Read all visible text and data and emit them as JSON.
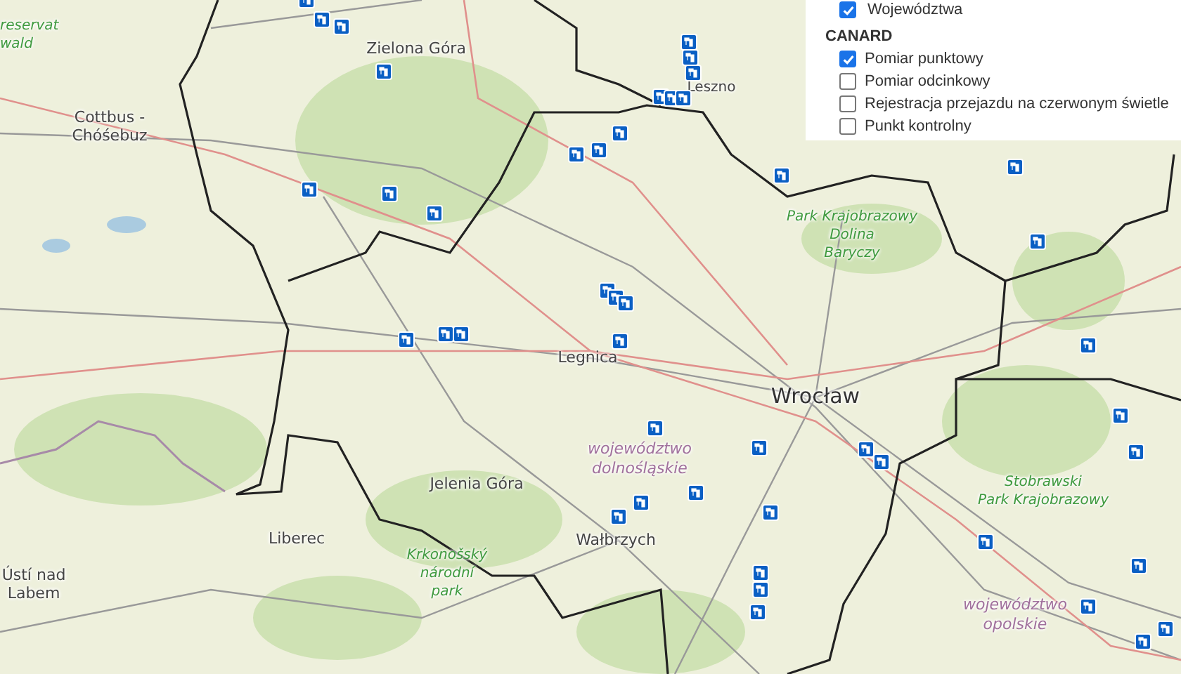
{
  "map": {
    "labels": [
      {
        "kind": "park",
        "lines": [
          "reservat",
          "wald"
        ]
      },
      {
        "kind": "city",
        "lines": [
          "Zielona Góra"
        ]
      },
      {
        "kind": "town",
        "lines": [
          "Leszno"
        ]
      },
      {
        "kind": "city",
        "lines": [
          "Cottbus -",
          "Chóśebuz"
        ]
      },
      {
        "kind": "park",
        "lines": [
          "Park Krajobrazowy",
          "Dolina",
          "Baryczy"
        ]
      },
      {
        "kind": "city",
        "lines": [
          "Legnica"
        ]
      },
      {
        "kind": "major",
        "lines": [
          "Wrocław"
        ]
      },
      {
        "kind": "region",
        "lines": [
          "województwo",
          "dolnośląskie"
        ]
      },
      {
        "kind": "city",
        "lines": [
          "Jelenia Góra"
        ]
      },
      {
        "kind": "city",
        "lines": [
          "Wałbrzych"
        ]
      },
      {
        "kind": "city",
        "lines": [
          "Liberec"
        ]
      },
      {
        "kind": "city",
        "lines": [
          "Ústí nad",
          "Labem"
        ]
      },
      {
        "kind": "park",
        "lines": [
          "Krkonošský",
          "národní",
          "park"
        ]
      },
      {
        "kind": "park",
        "lines": [
          "Stobrawski",
          "Park Krajobrazowy"
        ]
      },
      {
        "kind": "region",
        "lines": [
          "województwo",
          "opolskie"
        ]
      }
    ]
  },
  "layers_panel": {
    "top_item": {
      "label": "Województwa",
      "checked": true
    },
    "group_title": "CANARD",
    "items": [
      {
        "label": "Pomiar punktowy",
        "checked": true
      },
      {
        "label": "Pomiar odcinkowy",
        "checked": false
      },
      {
        "label": "Rejestracja przejazdu na czerwonym świetle",
        "checked": false
      },
      {
        "label": "Punkt kontrolny",
        "checked": false
      }
    ]
  }
}
